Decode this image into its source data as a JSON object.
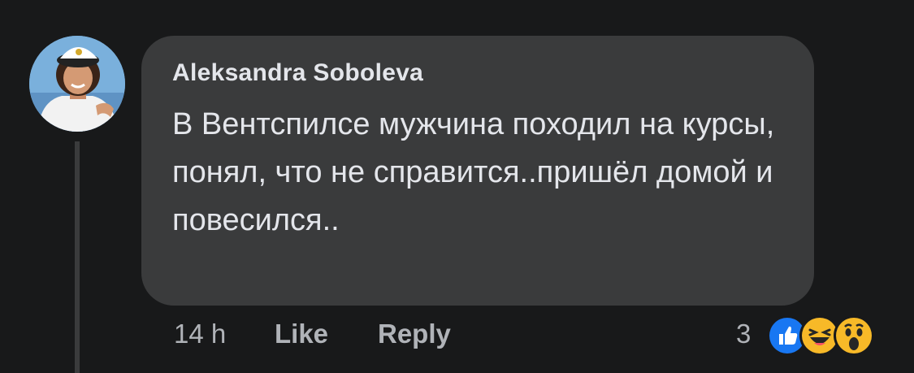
{
  "comment": {
    "author": "Aleksandra Soboleva",
    "text": "В Вентспилсе мужчина походил на курсы, понял, что не справится..пришёл домой и повесился..",
    "timestamp": "14 h",
    "actions": {
      "like_label": "Like",
      "reply_label": "Reply"
    },
    "reactions": {
      "count": "3",
      "types": [
        "like-icon",
        "haha-icon",
        "wow-icon"
      ]
    }
  },
  "colors": {
    "background": "#18191a",
    "bubble": "#3a3b3c",
    "primary_text": "#e4e6eb",
    "secondary_text": "#b0b3b8",
    "like_blue": "#1877f2",
    "emoji_yellow": "#f7b928"
  }
}
